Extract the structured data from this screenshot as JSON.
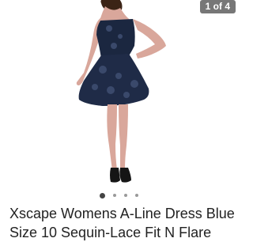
{
  "gallery": {
    "counter": "1 of 4",
    "image_alt": "Navy blue sequin-lace A-line dress worn by model",
    "slide_count": 4,
    "active_slide": 1
  },
  "product": {
    "title": "Xscape Womens A-Line Dress Blue Size 10 Sequin-Lace Fit N Flare"
  },
  "colors": {
    "dress": "#1b2740",
    "skin": "#d9a79b",
    "counter_bg": "#777777"
  }
}
